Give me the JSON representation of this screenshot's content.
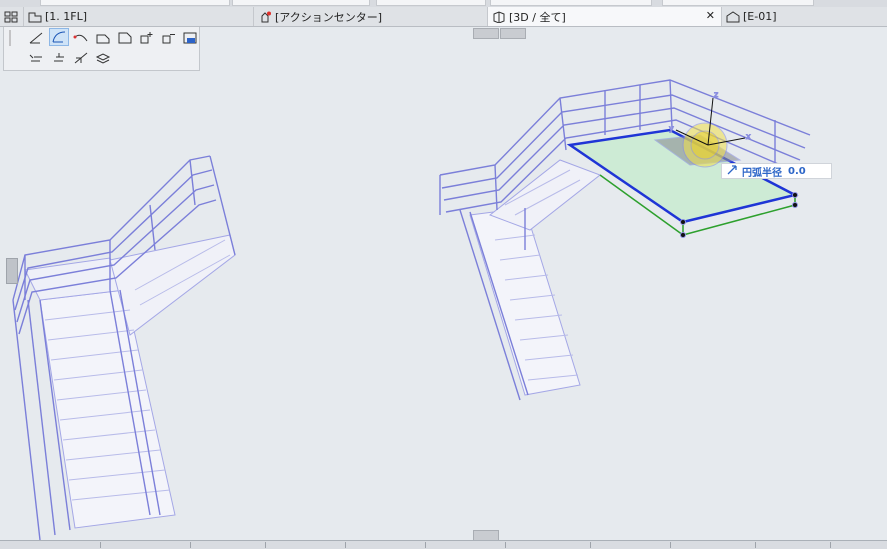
{
  "tabs": [
    {
      "label": "[1. 1FL]"
    },
    {
      "label": "[アクションセンター]"
    },
    {
      "label": "[3D / 全て]"
    },
    {
      "label": "[E-01]"
    }
  ],
  "tooltip": {
    "label": "円弧半径",
    "value": "0.0"
  },
  "axes": {
    "x": "x",
    "y": "y",
    "z": "z"
  },
  "colors": {
    "canvas": "#e6eaee",
    "railing": "#7b7fd9",
    "selection_blue": "#1f35d6",
    "selection_green": "#2da02d",
    "slab_fill": "#cdebd5",
    "highlight": "#f1e04a"
  },
  "icons": {
    "floorplan": "floorplan-icon",
    "action_center": "action-center-icon",
    "view3d": "3d-view-icon",
    "elevation": "elevation-icon",
    "arc_radius": "arc-radius-icon"
  }
}
